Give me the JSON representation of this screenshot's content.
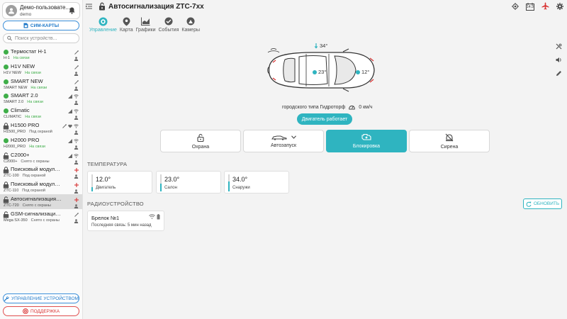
{
  "user": {
    "name": "Демо-пользовате...",
    "login": "demo"
  },
  "sidebar": {
    "sim_button": "СИМ-КАРТЫ",
    "search_placeholder": "Поиск устройств...",
    "manage_button": "УПРАВЛЕНИЕ УСТРОЙСТВОМ",
    "support_button": "ПОДДЕРЖКА",
    "devices": [
      {
        "name": "Термостат H-1",
        "model": "H-1",
        "status": "На связи",
        "indicator": "online"
      },
      {
        "name": "H1V NEW",
        "model": "H1V NEW",
        "status": "На связи",
        "indicator": "online"
      },
      {
        "name": "SMART NEW",
        "model": "SMART NEW",
        "status": "На связи",
        "indicator": "online"
      },
      {
        "name": "SMART 2.0",
        "model": "SMART 2.0",
        "status": "На связи",
        "indicator": "online"
      },
      {
        "name": "Climatic",
        "model": "CLIMATIC",
        "status": "На связи",
        "indicator": "online"
      },
      {
        "name": "H1500 PRO",
        "model": "H1500_PRO",
        "status": "Под охраной",
        "indicator": "locked"
      },
      {
        "name": "H2000 PRO",
        "model": "H2000_PRO",
        "status": "На связи",
        "indicator": "online"
      },
      {
        "name": "C2000+",
        "model": "C2000+",
        "status": "Снято с охраны",
        "indicator": "unlocked"
      },
      {
        "name": "Поисковый модуль ...",
        "model": "ZTC-100",
        "status": "Под охраной",
        "indicator": "locked"
      },
      {
        "name": "Поисковый модуль ...",
        "model": "ZTC-110",
        "status": "Под охраной",
        "indicator": "locked"
      },
      {
        "name": "Автосигнализация Z...",
        "model": "ZTC-720",
        "status": "Снято с охраны",
        "indicator": "unlocked",
        "selected": true
      },
      {
        "name": "GSM-сигнализация ...",
        "model": "Mega SX-350",
        "status": "Снято с охраны",
        "indicator": "unlocked"
      }
    ]
  },
  "header": {
    "title": "Автосигнализация ZTC-7xx",
    "calendar_label": "14:3"
  },
  "tabs": [
    {
      "label": "Управление",
      "icon": "control-icon",
      "active": true
    },
    {
      "label": "Карта",
      "icon": "map-pin-icon"
    },
    {
      "label": "Графики",
      "icon": "chart-icon"
    },
    {
      "label": "События",
      "icon": "events-icon"
    },
    {
      "label": "Камеры",
      "icon": "camera-icon"
    }
  ],
  "car": {
    "temp_top": "34°",
    "temp_cabin": "23°",
    "temp_engine": "12°",
    "location_text": "городского типа Гидроторф",
    "speed": "0 км/ч",
    "engine_button": "Двигатель работает"
  },
  "controls": [
    {
      "label": "Охрана",
      "icon": "unlock-icon"
    },
    {
      "label": "Автозапуск",
      "icon": "car-start-icon"
    },
    {
      "label": "Блокировка",
      "icon": "engine-block-icon",
      "active": true
    },
    {
      "label": "Сирена",
      "icon": "siren-off-icon"
    }
  ],
  "temperature": {
    "title": "ТЕМПЕРАТУРА",
    "cards": [
      {
        "value": "12.0°",
        "label": "Двигатель",
        "level": 0.25
      },
      {
        "value": "23.0°",
        "label": "Салон",
        "level": 0.45
      },
      {
        "value": "34.0°",
        "label": "Снаружи",
        "level": 0.6
      }
    ]
  },
  "radio": {
    "title": "РАДИОУСТРОЙСТВО",
    "refresh_button": "ОБНОВИТЬ",
    "device_name": "Брелок №1",
    "last_seen": "Последняя связь: 5 мин назад"
  },
  "colors": {
    "accent": "#2fb4c0",
    "primary": "#1e78c8",
    "online": "#3fae49",
    "danger": "#d83232"
  }
}
